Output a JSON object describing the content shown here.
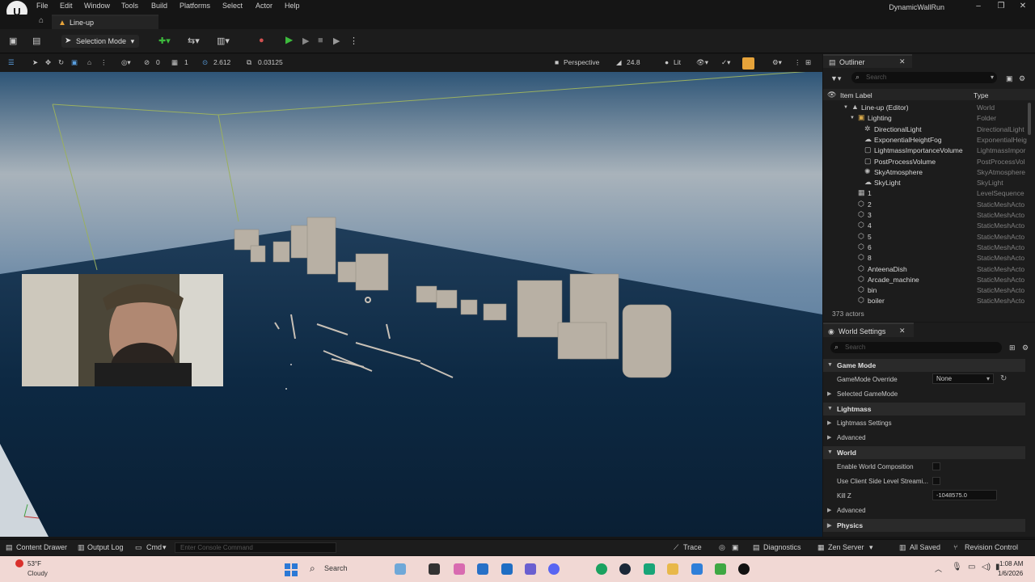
{
  "menubar": {
    "logo": "U",
    "items": [
      "File",
      "Edit",
      "Window",
      "Tools",
      "Build",
      "Platforms",
      "Select",
      "Actor",
      "Help"
    ],
    "window_title": "DynamicWallRun",
    "window_buttons": [
      "–",
      "❐",
      "✕"
    ]
  },
  "tabs": {
    "level_tab": "Line-up"
  },
  "toolbar": {
    "selection_mode": "Selection Mode"
  },
  "viewport_toolbar": {
    "rotate_snap": "0",
    "scale_snap_left": "1",
    "grid_value": "2.612",
    "scale_value": "0.03125",
    "view_mode": "Perspective",
    "fov": "24.8",
    "lighting": "Lit"
  },
  "outliner": {
    "tab_label": "Outliner",
    "search_placeholder": "Search",
    "col_label": "Item Label",
    "col_type": "Type",
    "rows": [
      {
        "label": "Line-up (Editor)",
        "type": "World"
      },
      {
        "label": "Lighting",
        "type": "Folder"
      },
      {
        "label": "DirectionalLight",
        "type": "DirectionalLight"
      },
      {
        "label": "ExponentialHeightFog",
        "type": "ExponentialHeig"
      },
      {
        "label": "LightmassImportanceVolume",
        "type": "LightmassImpor"
      },
      {
        "label": "PostProcessVolume",
        "type": "PostProcessVol"
      },
      {
        "label": "SkyAtmosphere",
        "type": "SkyAtmosphere"
      },
      {
        "label": "SkyLight",
        "type": "SkyLight"
      },
      {
        "label": "1",
        "type": "LevelSequence"
      },
      {
        "label": "2",
        "type": "StaticMeshActo"
      },
      {
        "label": "3",
        "type": "StaticMeshActo"
      },
      {
        "label": "4",
        "type": "StaticMeshActo"
      },
      {
        "label": "5",
        "type": "StaticMeshActo"
      },
      {
        "label": "6",
        "type": "StaticMeshActo"
      },
      {
        "label": "8",
        "type": "StaticMeshActo"
      },
      {
        "label": "AnteenaDish",
        "type": "StaticMeshActo"
      },
      {
        "label": "Arcade_machine",
        "type": "StaticMeshActo"
      },
      {
        "label": "bin",
        "type": "StaticMeshActo"
      },
      {
        "label": "boiler",
        "type": "StaticMeshActo"
      }
    ],
    "actor_count": "373 actors"
  },
  "world_settings": {
    "tab_label": "World Settings",
    "search_placeholder": "Search",
    "game_mode": "Game Mode",
    "gamemode_override": "GameMode Override",
    "gamemode_value": "None",
    "selected_gamemode": "Selected GameMode",
    "lightmass": "Lightmass",
    "lightmass_settings": "Lightmass Settings",
    "advanced1": "Advanced",
    "world": "World",
    "enable_world_composition": "Enable World Composition",
    "use_client_side": "Use Client Side Level Streami...",
    "kill_z": "Kill Z",
    "kill_z_value": "-1048575.0",
    "advanced2": "Advanced",
    "physics": "Physics"
  },
  "bottombar": {
    "content_drawer": "Content Drawer",
    "output_log": "Output Log",
    "cmd": "Cmd",
    "console_placeholder": "Enter Console Command",
    "trace": "Trace",
    "diagnostics": "Diagnostics",
    "zen_server": "Zen Server",
    "all_saved": "All Saved",
    "revision_control": "Revision Control"
  },
  "taskbar": {
    "temperature": "53°F",
    "weather": "Cloudy",
    "search": "Search",
    "time": "1:08 AM",
    "date": "1/6/2026"
  },
  "colors": {
    "sky_top": "#2c5272",
    "horizon": "#a7b0b8",
    "floor": "#0e2a45",
    "accent_orange": "#e6a33a",
    "play_green": "#3dbb3d"
  }
}
